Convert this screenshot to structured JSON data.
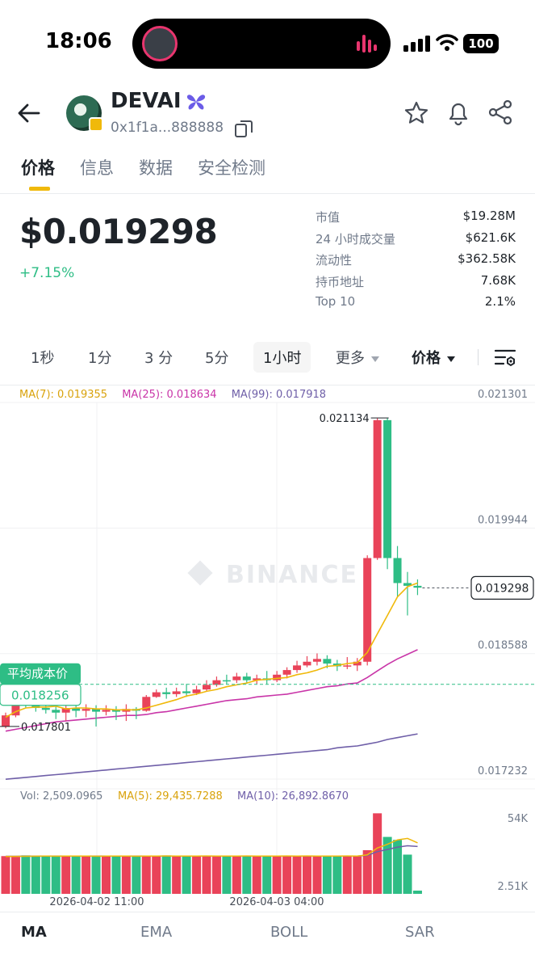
{
  "status_bar": {
    "time": "18:06",
    "battery": "100"
  },
  "header": {
    "token_name": "DEVAI",
    "address": "0x1f1a...888888"
  },
  "tabs": [
    {
      "label": "价格",
      "active": true
    },
    {
      "label": "信息",
      "active": false
    },
    {
      "label": "数据",
      "active": false
    },
    {
      "label": "安全检测",
      "active": false
    }
  ],
  "price": {
    "value": "$0.019298",
    "change": "+7.15%"
  },
  "stats": [
    {
      "label": "市值",
      "value": "$19.28M"
    },
    {
      "label": "24 小时成交量",
      "value": "$621.6K"
    },
    {
      "label": "流动性",
      "value": "$362.58K"
    },
    {
      "label": "持币地址",
      "value": "7.68K"
    },
    {
      "label": "Top 10",
      "value": "2.1%"
    }
  ],
  "intervals": {
    "items": [
      "1秒",
      "1分",
      "3 分",
      "5分",
      "1小时"
    ],
    "active": "1小时",
    "more": "更多",
    "type": "价格"
  },
  "colors": {
    "up": "#2ebd85",
    "down": "#e94359",
    "ma7": "#f0b90b",
    "ma25": "#c935a8",
    "ma99": "#6f5fa8",
    "accent": "#f0b90b"
  },
  "chart_data": {
    "type": "candlestick",
    "ma_legend": {
      "ma7": "MA(7): 0.019355",
      "ma25": "MA(25): 0.018634",
      "ma99": "MA(99): 0.017918"
    },
    "y_ticks": [
      "0.021301",
      "0.019944",
      "0.018588",
      "0.017232"
    ],
    "ylim": [
      0.017232,
      0.021301
    ],
    "last_price_label": "0.019298",
    "last_price": 0.019298,
    "high_label": "0.021134",
    "high": 0.021134,
    "low_label": "0.017801",
    "low": 0.017801,
    "avg_cost": {
      "title": "平均成本价",
      "value": "0.018256",
      "price": 0.018256
    },
    "watermark": "BINANCE",
    "x_labels": [
      "2026-04-02 11:00",
      "2026-04-03 04:00"
    ],
    "candles": [
      [
        0.01792,
        0.01795,
        0.01778,
        0.0178
      ],
      [
        0.01809,
        0.0181,
        0.0179,
        0.01792
      ],
      [
        0.01803,
        0.01816,
        0.018,
        0.01809
      ],
      [
        0.018,
        0.01812,
        0.01796,
        0.01803
      ],
      [
        0.01798,
        0.01806,
        0.01794,
        0.018
      ],
      [
        0.01795,
        0.01802,
        0.01788,
        0.01798
      ],
      [
        0.018,
        0.01804,
        0.01786,
        0.01795
      ],
      [
        0.01797,
        0.01806,
        0.0179,
        0.018
      ],
      [
        0.01799,
        0.01804,
        0.0179,
        0.01797
      ],
      [
        0.01796,
        0.01803,
        0.0178,
        0.01799
      ],
      [
        0.01798,
        0.01803,
        0.01792,
        0.01796
      ],
      [
        0.01796,
        0.01802,
        0.01787,
        0.01798
      ],
      [
        0.01799,
        0.01804,
        0.01786,
        0.01796
      ],
      [
        0.01797,
        0.01801,
        0.01788,
        0.01799
      ],
      [
        0.01812,
        0.01814,
        0.01796,
        0.01797
      ],
      [
        0.01817,
        0.0182,
        0.01811,
        0.01812
      ],
      [
        0.01815,
        0.01822,
        0.0181,
        0.01817
      ],
      [
        0.01818,
        0.01822,
        0.01812,
        0.01815
      ],
      [
        0.01816,
        0.01826,
        0.01812,
        0.01818
      ],
      [
        0.0182,
        0.01824,
        0.01814,
        0.01816
      ],
      [
        0.01825,
        0.0183,
        0.01818,
        0.0182
      ],
      [
        0.0183,
        0.01834,
        0.01823,
        0.01825
      ],
      [
        0.0183,
        0.01836,
        0.01826,
        0.0183
      ],
      [
        0.01834,
        0.01838,
        0.01827,
        0.0183
      ],
      [
        0.0183,
        0.01838,
        0.01826,
        0.01834
      ],
      [
        0.01832,
        0.01836,
        0.01826,
        0.0183
      ],
      [
        0.0183,
        0.0184,
        0.01826,
        0.01832
      ],
      [
        0.01836,
        0.0184,
        0.01828,
        0.0183
      ],
      [
        0.01841,
        0.01844,
        0.01832,
        0.01836
      ],
      [
        0.01846,
        0.01851,
        0.01838,
        0.01841
      ],
      [
        0.0185,
        0.01856,
        0.01844,
        0.01846
      ],
      [
        0.01853,
        0.01859,
        0.01846,
        0.0185
      ],
      [
        0.01848,
        0.01857,
        0.01843,
        0.01853
      ],
      [
        0.01845,
        0.01852,
        0.0184,
        0.01848
      ],
      [
        0.01846,
        0.01855,
        0.01842,
        0.01845
      ],
      [
        0.0185,
        0.01854,
        0.0184,
        0.01846
      ],
      [
        0.01962,
        0.01965,
        0.01846,
        0.0185
      ],
      [
        0.02111,
        0.02113,
        0.0196,
        0.01962
      ],
      [
        0.01962,
        0.02113,
        0.0195,
        0.02111
      ],
      [
        0.01935,
        0.01975,
        0.0192,
        0.01962
      ],
      [
        0.01932,
        0.01947,
        0.019,
        0.01935
      ],
      [
        0.0193,
        0.01939,
        0.01922,
        0.01932
      ]
    ],
    "ma7": [
      0.0179,
      0.01796,
      0.018,
      0.01801,
      0.01801,
      0.01802,
      0.01799,
      0.018,
      0.018,
      0.01799,
      0.01799,
      0.01798,
      0.01798,
      0.01798,
      0.018,
      0.01803,
      0.01806,
      0.01809,
      0.01813,
      0.01815,
      0.01818,
      0.0182,
      0.01823,
      0.01825,
      0.01827,
      0.0183,
      0.01831,
      0.01832,
      0.01833,
      0.01836,
      0.01838,
      0.01841,
      0.01845,
      0.01846,
      0.01848,
      0.01849,
      0.0186,
      0.0188,
      0.019,
      0.0192,
      0.01931,
      0.01935
    ],
    "ma25": [
      0.01775,
      0.01777,
      0.01779,
      0.01781,
      0.01783,
      0.01785,
      0.01786,
      0.01787,
      0.01788,
      0.01789,
      0.0179,
      0.01791,
      0.01792,
      0.01792,
      0.01793,
      0.01795,
      0.01796,
      0.01798,
      0.018,
      0.01802,
      0.01804,
      0.01806,
      0.01808,
      0.01809,
      0.0181,
      0.01812,
      0.01813,
      0.01814,
      0.01815,
      0.01817,
      0.01819,
      0.01821,
      0.01823,
      0.01824,
      0.01826,
      0.01827,
      0.01833,
      0.0184,
      0.01847,
      0.01853,
      0.01858,
      0.01863
    ],
    "ma99": [
      0.01723,
      0.01724,
      0.01725,
      0.01726,
      0.01727,
      0.01728,
      0.01729,
      0.0173,
      0.01731,
      0.01732,
      0.01733,
      0.01734,
      0.01735,
      0.01736,
      0.01737,
      0.01738,
      0.01739,
      0.0174,
      0.01741,
      0.01742,
      0.01743,
      0.01744,
      0.01745,
      0.01746,
      0.01747,
      0.01748,
      0.01749,
      0.0175,
      0.01751,
      0.01752,
      0.01753,
      0.01754,
      0.01755,
      0.01757,
      0.01758,
      0.01759,
      0.01761,
      0.01763,
      0.01766,
      0.01768,
      0.0177,
      0.01772
    ],
    "volume": {
      "legend": {
        "vol": "Vol: 2,509.0965",
        "ma5": "MA(5): 29,435.7288",
        "ma10": "MA(10): 26,892.8670"
      },
      "y_ticks": [
        "54K",
        "2.51K"
      ],
      "ylim": [
        2510,
        54000
      ],
      "values": [
        27000,
        26500,
        27500,
        26800,
        27200,
        26900,
        27400,
        26600,
        27100,
        26800,
        27300,
        26700,
        27000,
        26900,
        27200,
        26800,
        27500,
        26700,
        27100,
        26900,
        27300,
        26600,
        27000,
        26800,
        27400,
        26700,
        27100,
        26900,
        27200,
        26800,
        27300,
        26700,
        27000,
        26900,
        27100,
        26800,
        31000,
        56000,
        40000,
        38000,
        28000,
        2509
      ],
      "ma5": [
        26800,
        26850,
        26900,
        26950,
        27000,
        26950,
        27000,
        27050,
        27000,
        26950,
        27000,
        27050,
        27000,
        26950,
        27000,
        27050,
        27100,
        27050,
        27000,
        27050,
        27100,
        27050,
        27000,
        27050,
        27100,
        27050,
        27000,
        27050,
        27100,
        27050,
        27100,
        27050,
        27000,
        27050,
        27100,
        27050,
        27800,
        32500,
        35000,
        38000,
        39000,
        36000
      ],
      "ma10": [
        26900,
        26900,
        26950,
        26950,
        27000,
        27000,
        27000,
        27000,
        27000,
        27000,
        27000,
        27000,
        27000,
        27000,
        27000,
        27000,
        27050,
        27050,
        27050,
        27050,
        27050,
        27050,
        27050,
        27050,
        27050,
        27050,
        27050,
        27050,
        27050,
        27050,
        27050,
        27050,
        27050,
        27050,
        27050,
        27050,
        27500,
        30000,
        31500,
        33000,
        34000,
        33500
      ]
    }
  },
  "footer_tabs": [
    {
      "label": "MA",
      "active": true
    },
    {
      "label": "EMA",
      "active": false
    },
    {
      "label": "BOLL",
      "active": false
    },
    {
      "label": "SAR",
      "active": false
    }
  ]
}
